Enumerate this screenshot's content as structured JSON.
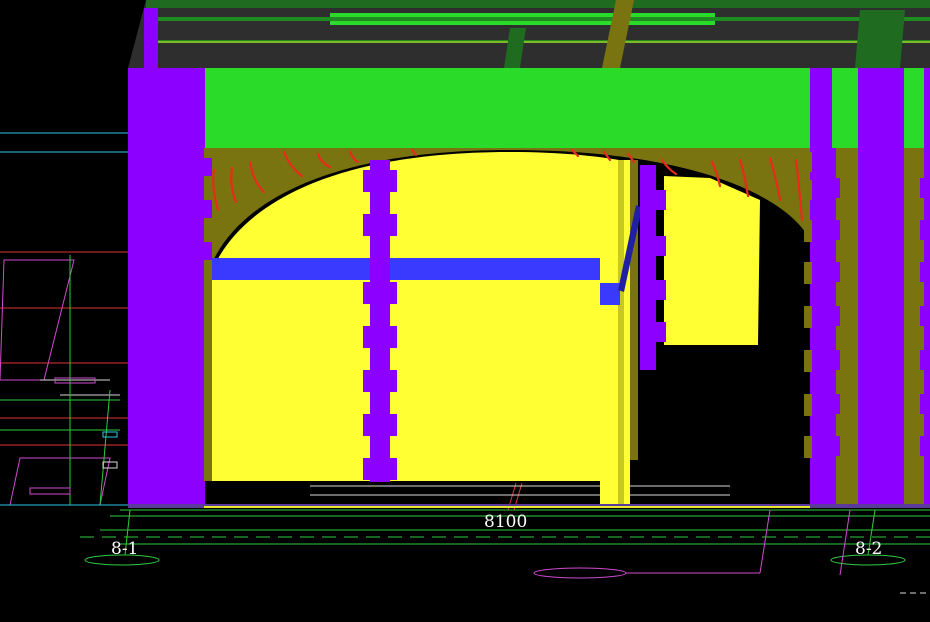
{
  "viewport": {
    "background": "#000000"
  },
  "labels": {
    "dimension_total": "8100",
    "axis_left": "8-1",
    "axis_right": "8-2"
  },
  "colors": {
    "column": "#8b00ff",
    "beam": "#2adb2a",
    "arch_fill": "#ffff33",
    "arch_frame": "#7a7410",
    "rebar_lines": "#e82b1a",
    "tie_beam": "#3a3aff",
    "dark_top": "#2e2e2e",
    "cad_green": "#2ecc40",
    "cad_magenta": "#d04ad0",
    "cad_cyan": "#2ec6e6",
    "cad_red": "#e23232",
    "cad_white": "#d8d8d8",
    "cad_yellow": "#e6e62e"
  }
}
